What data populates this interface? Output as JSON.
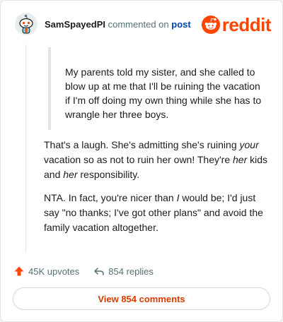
{
  "header": {
    "username": "SamSpayedPI",
    "action_text": "commented on",
    "post_link": "post",
    "brand_name": "reddit",
    "brand_color": "#ff4500"
  },
  "quote": {
    "text": "My parents told my sister, and she called to blow up at me that I'll be ruining the vacation if I'm off doing my own thing while she has to wrangle her three boys."
  },
  "comment": {
    "p1_a": "That's a laugh. She's admitting she's ruining ",
    "p1_em1": "your",
    "p1_b": " vacation so as not to ruin her own! They're ",
    "p1_em2": "her",
    "p1_c": " kids and ",
    "p1_em3": "her",
    "p1_d": " responsibility.",
    "p2_a": "NTA. In fact, you're nicer than ",
    "p2_em1": "I",
    "p2_b": " would be; I'd just say \"no thanks; I've got other plans\" and avoid the family vacation altogether."
  },
  "footer": {
    "upvotes": "45K upvotes",
    "replies": "854 replies",
    "upvote_icon": "upvote-arrow-icon",
    "reply_icon": "reply-arrow-icon"
  },
  "view_button": {
    "label": "View 854 comments",
    "color": "#d93a00"
  }
}
